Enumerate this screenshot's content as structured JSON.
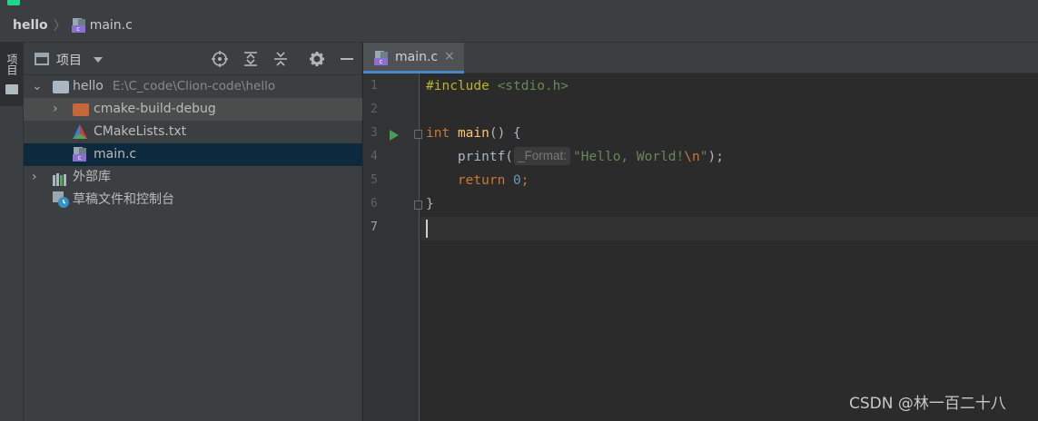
{
  "breadcrumb": {
    "project": "hello",
    "file": "main.c"
  },
  "project_panel": {
    "side_tab_label": "项目",
    "view_label": "项目",
    "header_icons": [
      "locate-icon",
      "expand-all-icon",
      "collapse-all-icon",
      "gear-icon",
      "minimize-icon"
    ],
    "tree": {
      "root": {
        "label": "hello",
        "path": "E:\\C_code\\Clion-code\\hello"
      },
      "build_dir": "cmake-build-debug",
      "cmake_file": "CMakeLists.txt",
      "main_file": "main.c",
      "external_libs": "外部库",
      "scratches": "草稿文件和控制台"
    }
  },
  "editor": {
    "tab_label": "main.c",
    "tab_close": "×",
    "line_numbers": [
      "1",
      "2",
      "3",
      "4",
      "5",
      "6",
      "7"
    ],
    "code": {
      "include_kw": "#include",
      "include_path": "<stdio.h>",
      "int_kw": "int",
      "main_name": "main",
      "main_rest": "() {",
      "printf_name": "printf(",
      "hint_label": "_Format:",
      "string_part": "\"Hello, World!",
      "escape": "\\n",
      "string_end": "\"",
      "printf_end": ");",
      "return_kw": "return",
      "return_val": "0",
      "semicolon": ";",
      "close_brace": "}"
    },
    "current_line": 7
  },
  "watermark": "CSDN @林一百二十八",
  "colors": {
    "keyword": "#cc7832",
    "string": "#6a8759",
    "number": "#6897bb",
    "function": "#ffc66d",
    "selection": "#0d293e"
  }
}
